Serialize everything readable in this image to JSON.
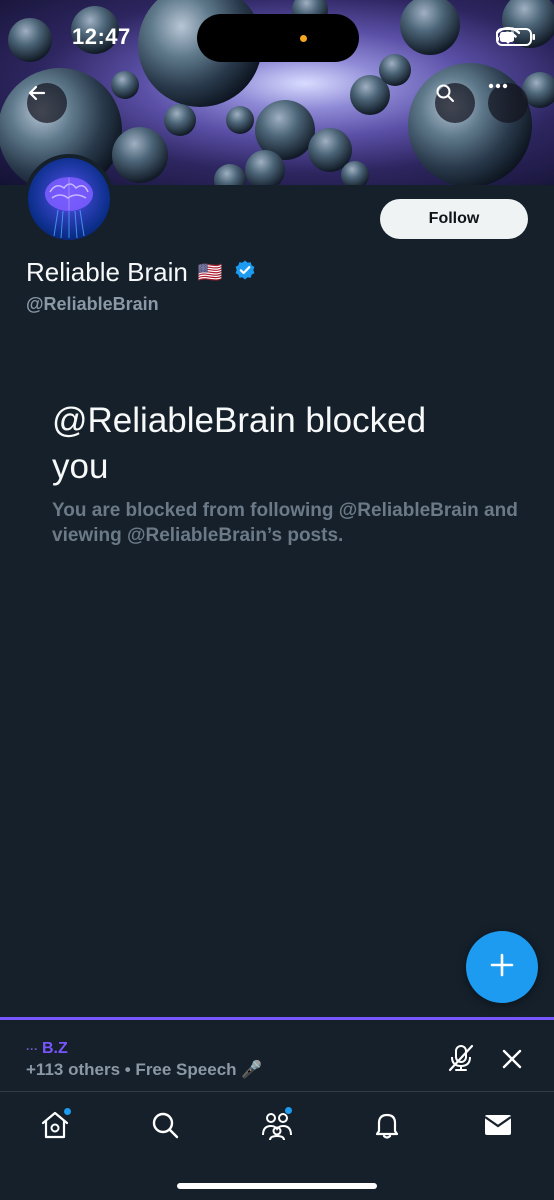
{
  "status_bar": {
    "time": "12:47"
  },
  "profile": {
    "name": "Reliable Brain",
    "flag": "🇺🇸",
    "handle": "@ReliableBrain",
    "verified": true,
    "follow_label": "Follow"
  },
  "blocked": {
    "title": "@ReliableBrain blocked you",
    "description": "You are blocked from following @ReliableBrain and viewing @ReliableBrain’s posts."
  },
  "space": {
    "host_dots": "···",
    "host": "B.Z",
    "info": "+113 others • Free Speech 🎤"
  },
  "nav": {
    "items": [
      "home-icon",
      "search-icon",
      "communities-icon",
      "notifications-icon",
      "messages-icon"
    ]
  },
  "colors": {
    "background": "#15202b",
    "accent": "#1d9bf0",
    "spaces_purple": "#7856ff",
    "muted_text": "#8b98a5"
  }
}
